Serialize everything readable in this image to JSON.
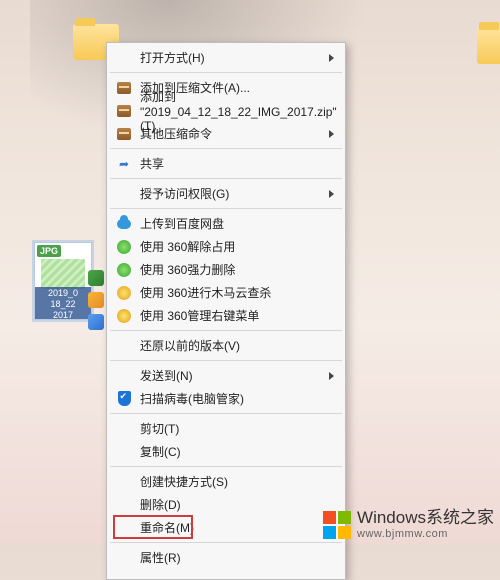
{
  "desktop": {
    "folder1": {
      "label": ""
    },
    "folder2": {
      "label": ""
    },
    "thumbnail": {
      "badge": "JPG",
      "caption_l1": "2019_0",
      "caption_l2": "18_22",
      "caption_l3": "2017"
    }
  },
  "menu": {
    "open_with": "打开方式(H)",
    "add_to_archive": "添加到压缩文件(A)...",
    "add_to_named_zip": "添加到 \"2019_04_12_18_22_IMG_2017.zip\" (T)",
    "other_compress": "其他压缩命令",
    "share": "共享",
    "grant_access": "授予访问权限(G)",
    "upload_baidu": "上传到百度网盘",
    "use_360_unoccupy": "使用 360解除占用",
    "use_360_forcedel": "使用 360强力删除",
    "use_360_trojan": "使用 360进行木马云查杀",
    "use_360_manage": "使用 360管理右键菜单",
    "restore_prev": "还原以前的版本(V)",
    "send_to": "发送到(N)",
    "scan_virus": "扫描病毒(电脑管家)",
    "cut": "剪切(T)",
    "copy": "复制(C)",
    "create_shortcut": "创建快捷方式(S)",
    "delete": "删除(D)",
    "rename": "重命名(M)",
    "properties": "属性(R)"
  },
  "watermark": {
    "title": "Windows系统之家",
    "url": "www.bjmmw.com"
  }
}
